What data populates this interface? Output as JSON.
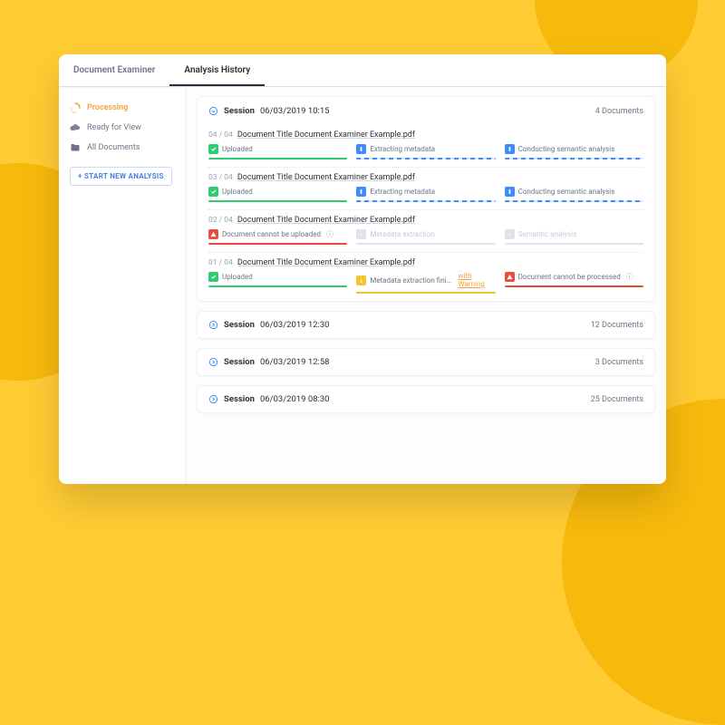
{
  "tabs": {
    "left": "Document Examiner",
    "right": "Analysis History"
  },
  "sidebar": {
    "items": [
      {
        "label": "Processing",
        "active": true,
        "icon": "spinner"
      },
      {
        "label": "Ready for View",
        "active": false,
        "icon": "cloud"
      },
      {
        "label": "All Documents",
        "active": false,
        "icon": "folder"
      }
    ],
    "new_button": "+ START NEW ANALYSIS"
  },
  "session_word": "Session",
  "sessions": [
    {
      "expanded": true,
      "timestamp": "06/03/2019 10:15",
      "count_label": "4 Documents",
      "documents": [
        {
          "index": "04 / 04",
          "title": "Document Title Document Examiner Example.pdf",
          "stages": [
            {
              "label": "Uploaded",
              "badge": "green",
              "bar": "solid-green"
            },
            {
              "label": "Extracting metadata",
              "badge": "blue",
              "bar": "stripe-blue"
            },
            {
              "label": "Conducting semantic analysis",
              "badge": "blue",
              "bar": "stripe-blue"
            }
          ]
        },
        {
          "index": "03 / 04",
          "title": "Document Title Document Examiner Example.pdf",
          "stages": [
            {
              "label": "Uploaded",
              "badge": "green",
              "bar": "solid-green"
            },
            {
              "label": "Extracting metadata",
              "badge": "blue",
              "bar": "stripe-blue"
            },
            {
              "label": "Conducting semantic analysis",
              "badge": "blue",
              "bar": "stripe-blue"
            }
          ]
        },
        {
          "index": "02 / 04",
          "title": "Document Title Document Examiner Example.pdf",
          "stages": [
            {
              "label": "Document cannot be uploaded",
              "badge": "red",
              "bar": "solid-red",
              "info": true
            },
            {
              "label": "Metadata extraction",
              "badge": "gray",
              "bar": "solid-gray",
              "faded": true
            },
            {
              "label": "Semantic analysis",
              "badge": "gray",
              "bar": "solid-gray",
              "faded": true
            }
          ]
        },
        {
          "index": "01 / 04",
          "title": "Document Title Document Examiner Example.pdf",
          "stages": [
            {
              "label": "Uploaded",
              "badge": "green",
              "bar": "solid-green"
            },
            {
              "label": "Metadata extraction finished",
              "badge": "yellow",
              "bar": "solid-yellow",
              "warn_link": "with Warning"
            },
            {
              "label": "Document cannot be processed",
              "badge": "red",
              "bar": "solid-red",
              "info": true
            }
          ]
        }
      ]
    },
    {
      "expanded": false,
      "timestamp": "06/03/2019 12:30",
      "count_label": "12 Documents"
    },
    {
      "expanded": false,
      "timestamp": "06/03/2019 12:58",
      "count_label": "3 Documents"
    },
    {
      "expanded": false,
      "timestamp": "06/03/2019 08:30",
      "count_label": "25 Documents"
    }
  ],
  "colors": {
    "accent": "#f2a33c",
    "primary": "#3d8bfd",
    "danger": "#e74c3c",
    "success": "#2ecc71"
  }
}
